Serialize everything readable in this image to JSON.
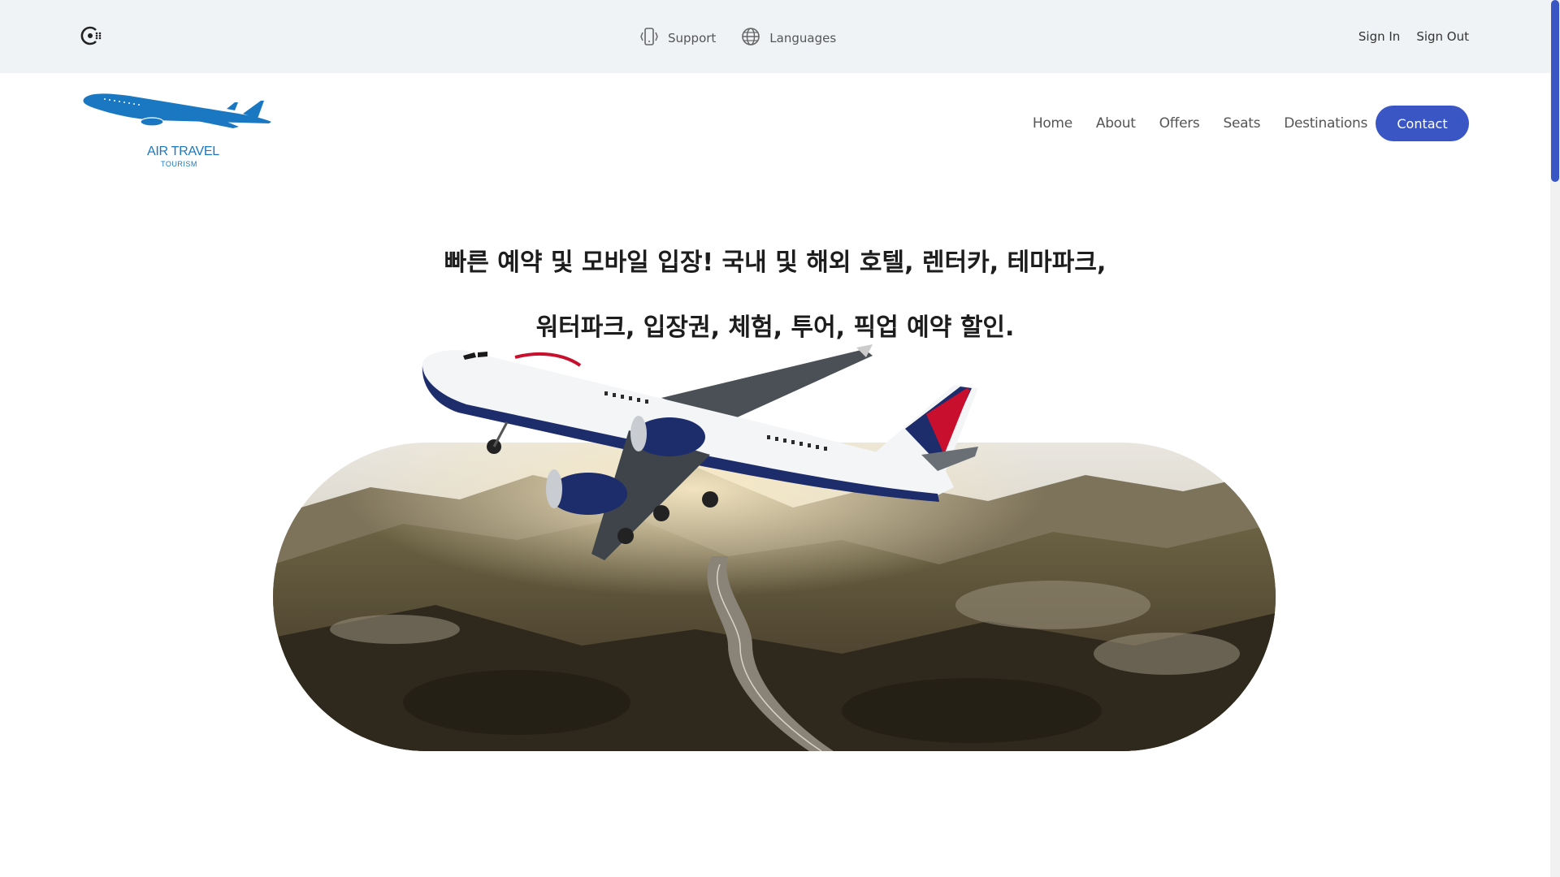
{
  "topbar": {
    "brand_icon": "circle-dots-logo-icon",
    "support_icon": "phone-vibrate-icon",
    "support_label": "Support",
    "languages_icon": "globe-icon",
    "languages_label": "Languages",
    "sign_in_label": "Sign In",
    "sign_out_label": "Sign Out"
  },
  "logo": {
    "title": "AIR TRAVEL",
    "subtitle": "TOURISM",
    "color": "#1a78c2"
  },
  "nav": {
    "items": [
      {
        "label": "Home"
      },
      {
        "label": "About"
      },
      {
        "label": "Offers"
      },
      {
        "label": "Seats"
      },
      {
        "label": "Destinations"
      }
    ],
    "contact_label": "Contact",
    "accent_color": "#3a56c5"
  },
  "hero": {
    "line1": "빠른 예약 및 모바일 입장! 국내 및 해외 호텔, 렌터카, 테마파크,",
    "line2": "워터파크, 입장권, 체험, 투어, 픽업 예약 할인.",
    "image": "airplane-over-mountain-road-photo"
  }
}
